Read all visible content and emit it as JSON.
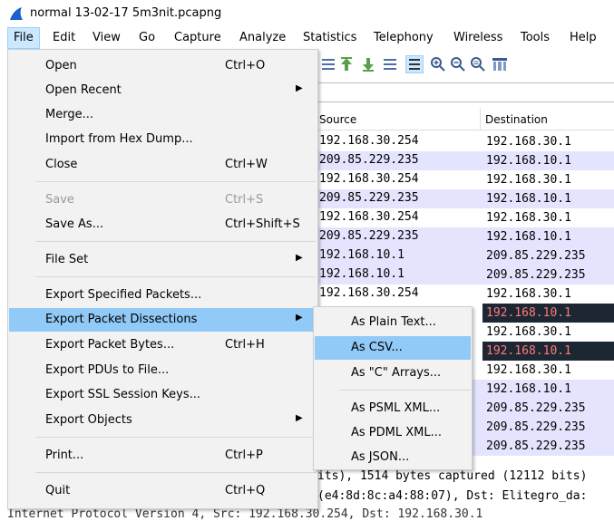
{
  "window": {
    "title": "normal 13-02-17 5m3nit.pcapng"
  },
  "menubar": [
    "File",
    "Edit",
    "View",
    "Go",
    "Capture",
    "Analyze",
    "Statistics",
    "Telephony",
    "Wireless",
    "Tools",
    "Help"
  ],
  "columns": {
    "source": "Source",
    "destination": "Destination"
  },
  "packets": [
    {
      "src": "192.168.30.254",
      "dst": "192.168.30.1"
    },
    {
      "src": "209.85.229.235",
      "dst": "192.168.10.1"
    },
    {
      "src": "192.168.30.254",
      "dst": "192.168.30.1"
    },
    {
      "src": "209.85.229.235",
      "dst": "192.168.10.1"
    },
    {
      "src": "192.168.30.254",
      "dst": "192.168.30.1"
    },
    {
      "src": "209.85.229.235",
      "dst": "192.168.10.1"
    },
    {
      "src": "192.168.10.1",
      "dst": "209.85.229.235"
    },
    {
      "src": "192.168.10.1",
      "dst": "209.85.229.235"
    },
    {
      "src": "192.168.30.254",
      "dst": "192.168.30.1"
    },
    {
      "src": "",
      "dst": "192.168.10.1"
    },
    {
      "src": "",
      "dst": "192.168.30.1"
    },
    {
      "src": "",
      "dst": "192.168.10.1"
    },
    {
      "src": "",
      "dst": "192.168.30.1"
    },
    {
      "src": "",
      "dst": "192.168.10.1"
    },
    {
      "src": "",
      "dst": "209.85.229.235"
    },
    {
      "src": "",
      "dst": "209.85.229.235"
    },
    {
      "src": "",
      "dst": "209.85.229.235"
    }
  ],
  "details": {
    "line1": "its), 1514 bytes captured (12112 bits)",
    "line2": "(e4:8d:8c:a4:88:07), Dst: Elitegro_da:",
    "line3": "Internet Protocol Version 4, Src: 192.168.30.254, Dst: 192.168.30.1"
  },
  "file_menu": [
    {
      "label": "Open",
      "shortcut": "Ctrl+O"
    },
    {
      "label": "Open Recent",
      "shortcut": ""
    },
    {
      "label": "Merge...",
      "shortcut": ""
    },
    {
      "label": "Import from Hex Dump...",
      "shortcut": ""
    },
    {
      "label": "Close",
      "shortcut": "Ctrl+W"
    },
    {
      "label": "Save",
      "shortcut": "Ctrl+S"
    },
    {
      "label": "Save As...",
      "shortcut": "Ctrl+Shift+S"
    },
    {
      "label": "File Set",
      "shortcut": ""
    },
    {
      "label": "Export Specified Packets...",
      "shortcut": ""
    },
    {
      "label": "Export Packet Dissections",
      "shortcut": ""
    },
    {
      "label": "Export Packet Bytes...",
      "shortcut": "Ctrl+H"
    },
    {
      "label": "Export PDUs to File...",
      "shortcut": ""
    },
    {
      "label": "Export SSL Session Keys...",
      "shortcut": ""
    },
    {
      "label": "Export Objects",
      "shortcut": ""
    },
    {
      "label": "Print...",
      "shortcut": "Ctrl+P"
    },
    {
      "label": "Quit",
      "shortcut": "Ctrl+Q"
    }
  ],
  "submenu": [
    {
      "label": "As Plain Text..."
    },
    {
      "label": "As CSV..."
    },
    {
      "label": "As \"C\" Arrays..."
    },
    {
      "label": "As PSML XML..."
    },
    {
      "label": "As PDML XML..."
    },
    {
      "label": "As JSON..."
    }
  ],
  "icons": {
    "app": "wireshark-fin-icon",
    "submenu_arrow": "triangle-right-icon",
    "toolbar": [
      "align-icon",
      "go-first-icon",
      "go-last-icon",
      "autoscroll-icon",
      "colorize-icon",
      "zoom-in-icon",
      "zoom-out-icon",
      "zoom-normal-icon",
      "resize-columns-icon"
    ]
  },
  "colors": {
    "highlight": "#91c9f7",
    "menu_bg": "#f2f2f2",
    "row_alt": "#e4e4ff",
    "selected_row": "#1c2733",
    "selected_text": "#ff7b7b"
  }
}
